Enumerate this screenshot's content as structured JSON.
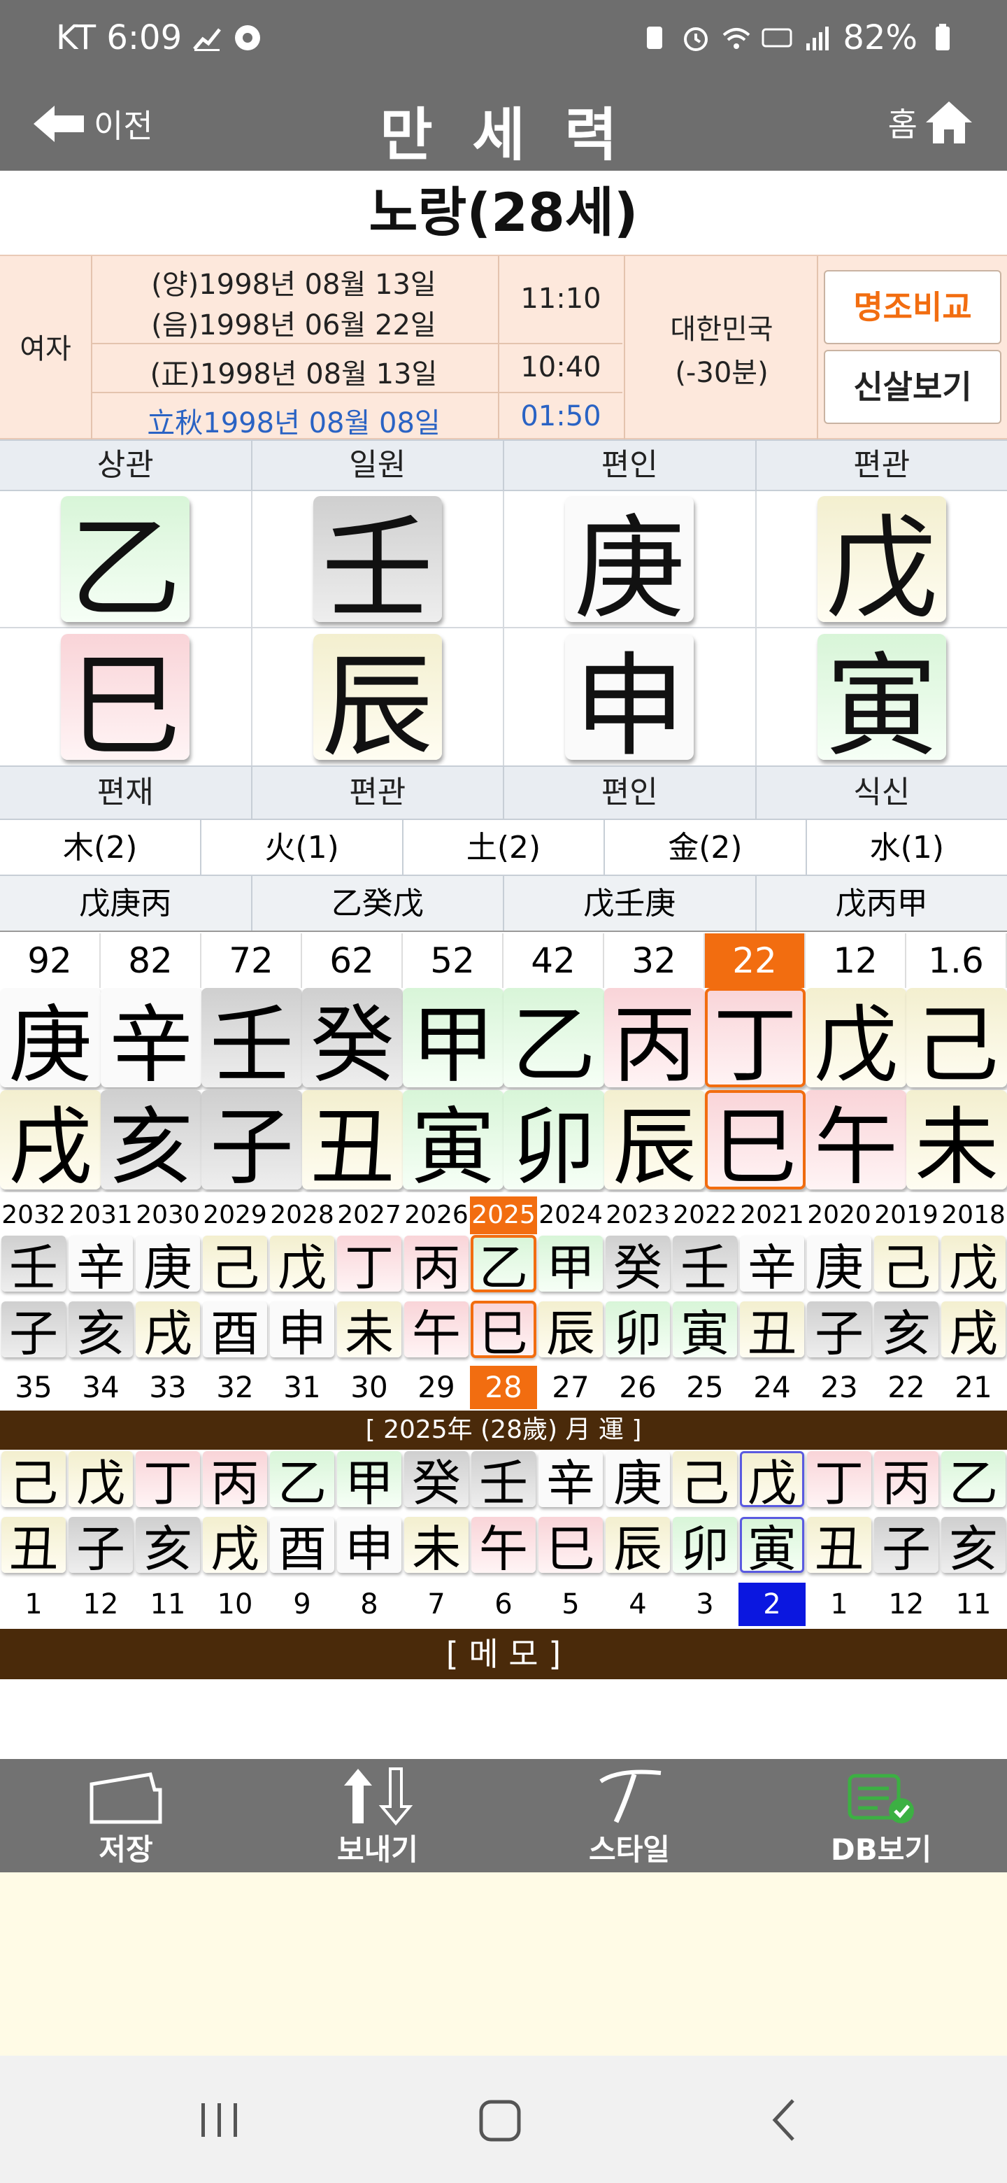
{
  "status": {
    "carrier_time": "KT 6:09",
    "battery": "82%"
  },
  "nav": {
    "back": "이전",
    "title": "만 세 력",
    "home": "홈"
  },
  "person": {
    "name_age": "노랑(28세)"
  },
  "info": {
    "gender": "여자",
    "solar": "(양)1998년 08월 13일",
    "lunar": "(음)1998년 06월 22일",
    "time1": "11:10",
    "corrected": "(正)1998년 08월 13일",
    "time2": "10:40",
    "term": "立秋1998년 08월 08일",
    "term_time": "01:50",
    "country": "대한민국",
    "offset": "(-30분)",
    "btn_compare": "명조비교",
    "btn_sinsal": "신살보기"
  },
  "sipsin_top": [
    "상관",
    "일원",
    "편인",
    "편관"
  ],
  "stems": [
    {
      "char": "乙",
      "color": "g"
    },
    {
      "char": "壬",
      "color": "gray"
    },
    {
      "char": "庚",
      "color": "w"
    },
    {
      "char": "戊",
      "color": "y"
    }
  ],
  "branches": [
    {
      "char": "巳",
      "color": "p"
    },
    {
      "char": "辰",
      "color": "y"
    },
    {
      "char": "申",
      "color": "w"
    },
    {
      "char": "寅",
      "color": "g"
    }
  ],
  "sipsin_bottom": [
    "편재",
    "편관",
    "편인",
    "식신"
  ],
  "ohang": [
    "木(2)",
    "火(1)",
    "土(2)",
    "金(2)",
    "水(1)"
  ],
  "jijanggan": [
    "戊庚丙",
    "乙癸戊",
    "戊壬庚",
    "戊丙甲"
  ],
  "daeun": {
    "ages": [
      "92",
      "82",
      "72",
      "62",
      "52",
      "42",
      "32",
      "22",
      "12",
      "1.6"
    ],
    "highlight_index": 7,
    "stems": [
      {
        "c": "庚",
        "k": "w"
      },
      {
        "c": "辛",
        "k": "w"
      },
      {
        "c": "壬",
        "k": "gray"
      },
      {
        "c": "癸",
        "k": "gray"
      },
      {
        "c": "甲",
        "k": "g"
      },
      {
        "c": "乙",
        "k": "g"
      },
      {
        "c": "丙",
        "k": "p"
      },
      {
        "c": "丁",
        "k": "p"
      },
      {
        "c": "戊",
        "k": "y"
      },
      {
        "c": "己",
        "k": "y"
      }
    ],
    "branches": [
      {
        "c": "戌",
        "k": "y"
      },
      {
        "c": "亥",
        "k": "gray"
      },
      {
        "c": "子",
        "k": "gray"
      },
      {
        "c": "丑",
        "k": "y"
      },
      {
        "c": "寅",
        "k": "g"
      },
      {
        "c": "卯",
        "k": "g"
      },
      {
        "c": "辰",
        "k": "y"
      },
      {
        "c": "巳",
        "k": "p"
      },
      {
        "c": "午",
        "k": "p"
      },
      {
        "c": "未",
        "k": "y"
      }
    ]
  },
  "seun": {
    "years": [
      "2032",
      "2031",
      "2030",
      "2029",
      "2028",
      "2027",
      "2026",
      "2025",
      "2024",
      "2023",
      "2022",
      "2021",
      "2020",
      "2019",
      "2018"
    ],
    "highlight_index": 7,
    "stems": [
      {
        "c": "壬",
        "k": "gray"
      },
      {
        "c": "辛",
        "k": "w"
      },
      {
        "c": "庚",
        "k": "w"
      },
      {
        "c": "己",
        "k": "y"
      },
      {
        "c": "戊",
        "k": "y"
      },
      {
        "c": "丁",
        "k": "p"
      },
      {
        "c": "丙",
        "k": "p"
      },
      {
        "c": "乙",
        "k": "g"
      },
      {
        "c": "甲",
        "k": "g"
      },
      {
        "c": "癸",
        "k": "gray"
      },
      {
        "c": "壬",
        "k": "gray"
      },
      {
        "c": "辛",
        "k": "w"
      },
      {
        "c": "庚",
        "k": "w"
      },
      {
        "c": "己",
        "k": "y"
      },
      {
        "c": "戊",
        "k": "y"
      }
    ],
    "branches": [
      {
        "c": "子",
        "k": "gray"
      },
      {
        "c": "亥",
        "k": "gray"
      },
      {
        "c": "戌",
        "k": "y"
      },
      {
        "c": "酉",
        "k": "w"
      },
      {
        "c": "申",
        "k": "w"
      },
      {
        "c": "未",
        "k": "y"
      },
      {
        "c": "午",
        "k": "p"
      },
      {
        "c": "巳",
        "k": "p"
      },
      {
        "c": "辰",
        "k": "y"
      },
      {
        "c": "卯",
        "k": "g"
      },
      {
        "c": "寅",
        "k": "g"
      },
      {
        "c": "丑",
        "k": "y"
      },
      {
        "c": "子",
        "k": "gray"
      },
      {
        "c": "亥",
        "k": "gray"
      },
      {
        "c": "戌",
        "k": "y"
      }
    ],
    "ages": [
      "35",
      "34",
      "33",
      "32",
      "31",
      "30",
      "29",
      "28",
      "27",
      "26",
      "25",
      "24",
      "23",
      "22",
      "21"
    ]
  },
  "wolun": {
    "header": "[ 2025年 (28歲) 月 運 ]",
    "highlight_index": 11,
    "stems": [
      {
        "c": "己",
        "k": "y"
      },
      {
        "c": "戊",
        "k": "y"
      },
      {
        "c": "丁",
        "k": "p"
      },
      {
        "c": "丙",
        "k": "p"
      },
      {
        "c": "乙",
        "k": "g"
      },
      {
        "c": "甲",
        "k": "g"
      },
      {
        "c": "癸",
        "k": "gray"
      },
      {
        "c": "壬",
        "k": "gray"
      },
      {
        "c": "辛",
        "k": "w"
      },
      {
        "c": "庚",
        "k": "w"
      },
      {
        "c": "己",
        "k": "y"
      },
      {
        "c": "戊",
        "k": "y"
      },
      {
        "c": "丁",
        "k": "p"
      },
      {
        "c": "丙",
        "k": "p"
      },
      {
        "c": "乙",
        "k": "g"
      }
    ],
    "branches": [
      {
        "c": "丑",
        "k": "y"
      },
      {
        "c": "子",
        "k": "gray"
      },
      {
        "c": "亥",
        "k": "gray"
      },
      {
        "c": "戌",
        "k": "y"
      },
      {
        "c": "酉",
        "k": "w"
      },
      {
        "c": "申",
        "k": "w"
      },
      {
        "c": "未",
        "k": "y"
      },
      {
        "c": "午",
        "k": "p"
      },
      {
        "c": "巳",
        "k": "p"
      },
      {
        "c": "辰",
        "k": "y"
      },
      {
        "c": "卯",
        "k": "g"
      },
      {
        "c": "寅",
        "k": "g"
      },
      {
        "c": "丑",
        "k": "y"
      },
      {
        "c": "子",
        "k": "gray"
      },
      {
        "c": "亥",
        "k": "gray"
      }
    ],
    "months": [
      "1",
      "12",
      "11",
      "10",
      "9",
      "8",
      "7",
      "6",
      "5",
      "4",
      "3",
      "2",
      "1",
      "12",
      "11"
    ]
  },
  "memo": "[ 메   모 ]",
  "toolbar": {
    "save": "저장",
    "send": "보내기",
    "style": "스타일",
    "db": "DB보기"
  },
  "colors": {
    "accent": "#f26d10",
    "brown": "#4a2a0a",
    "select_blue": "#0b17e0",
    "toolbar": "#727272",
    "db_green": "#3cb043"
  }
}
